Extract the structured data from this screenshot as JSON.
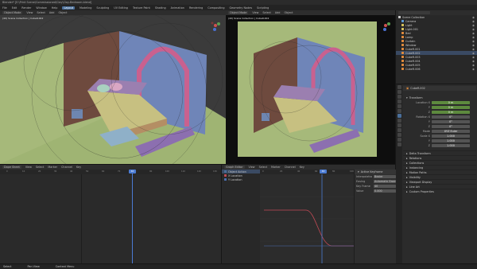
{
  "window_title": "Blender* [E:\\Print Scene\\Commissioned\\Clay\\Clay-Bedroom.blend]",
  "menu": [
    "File",
    "Edit",
    "Render",
    "Window",
    "Help",
    "Layout",
    "Modeling",
    "Sculpting",
    "UV Editing",
    "Texture Paint",
    "Shading",
    "Animation",
    "Rendering",
    "Compositing",
    "Geometry Nodes",
    "Scripting"
  ],
  "active_workspace": "Layout",
  "viewport_left": {
    "header": [
      "Object Mode",
      "View",
      "Select",
      "Add",
      "Object"
    ],
    "info": "(40) Scene Collection | CubeR.002",
    "view_label": "User Perspective"
  },
  "viewport_right": {
    "header": [
      "Object Mode",
      "View",
      "Select",
      "Add",
      "Object"
    ],
    "info": "(40) Scene Collection | CubeR.002",
    "view_label": "Camera Perspective"
  },
  "outliner": {
    "search_placeholder": "",
    "rows": [
      {
        "label": "Scene Collection",
        "type": "collection"
      },
      {
        "label": "Camera",
        "type": "camera"
      },
      {
        "label": "Light",
        "type": "light"
      },
      {
        "label": "Light.001",
        "type": "light"
      },
      {
        "label": "Bed",
        "type": "mesh"
      },
      {
        "label": "Lamp",
        "type": "mesh"
      },
      {
        "label": "Curtain",
        "type": "mesh"
      },
      {
        "label": "Window",
        "type": "mesh"
      },
      {
        "label": "CubeR.001",
        "type": "mesh"
      },
      {
        "label": "CubeR.002",
        "type": "mesh"
      },
      {
        "label": "CubeR.003",
        "type": "mesh"
      },
      {
        "label": "CubeR.004",
        "type": "mesh"
      },
      {
        "label": "CubeR.005",
        "type": "mesh"
      },
      {
        "label": "CubeR.006",
        "type": "mesh"
      }
    ]
  },
  "properties": {
    "object_name": "CubeR.002",
    "section_transform": "Transform",
    "fields": [
      {
        "label": "Location X",
        "value": "0 m"
      },
      {
        "label": "Y",
        "value": "0 m"
      },
      {
        "label": "Z",
        "value": "0 m"
      },
      {
        "label": "Rotation X",
        "value": "0°"
      },
      {
        "label": "Y",
        "value": "0°"
      },
      {
        "label": "Z",
        "value": "0°"
      },
      {
        "label": "Mode",
        "value": "XYZ Euler"
      },
      {
        "label": "Scale X",
        "value": "1.000"
      },
      {
        "label": "Y",
        "value": "1.000"
      },
      {
        "label": "Z",
        "value": "1.000"
      }
    ],
    "collapsed_sections": [
      "Delta Transform",
      "Relations",
      "Collections",
      "Instancing",
      "Motion Paths",
      "Visibility",
      "Viewport Display",
      "Line Art",
      "Custom Properties"
    ]
  },
  "dopesheet": {
    "header": [
      "Dope Sheet",
      "View",
      "Select",
      "Marker",
      "Channel",
      "Key"
    ],
    "frames": [
      "0",
      "10",
      "20",
      "30",
      "40",
      "50",
      "60",
      "70",
      "80",
      "90",
      "100",
      "110",
      "120",
      "130"
    ],
    "current_frame": "40"
  },
  "graph_editor": {
    "header": [
      "Graph Editor",
      "View",
      "Select",
      "Marker",
      "Channel",
      "Key"
    ],
    "channels": [
      "Object Action",
      "X Location",
      "Y Location"
    ],
    "frames": [
      "0",
      "20",
      "40",
      "60",
      "80",
      "100"
    ],
    "current_frame": "40",
    "panel_title": "Active Keyframe",
    "panel_rows": [
      {
        "label": "Interpolation",
        "value": "Bezier"
      },
      {
        "label": "Easing",
        "value": "Automatic Easing"
      },
      {
        "label": "Key Frame",
        "value": "40"
      },
      {
        "label": "Value",
        "value": "0.000"
      }
    ]
  },
  "status_bar": {
    "left": "Select",
    "middle": "Pan View",
    "right": "Context Menu"
  },
  "colors": {
    "floor": "#a6b97a",
    "wall_blue": "#7b8fc0",
    "wall_brown": "#7a5545",
    "curve_red": "#c24a55",
    "curve_blue": "#4a6fb3",
    "playhead": "#4b7bd3",
    "accent": "#4a6f9a"
  }
}
